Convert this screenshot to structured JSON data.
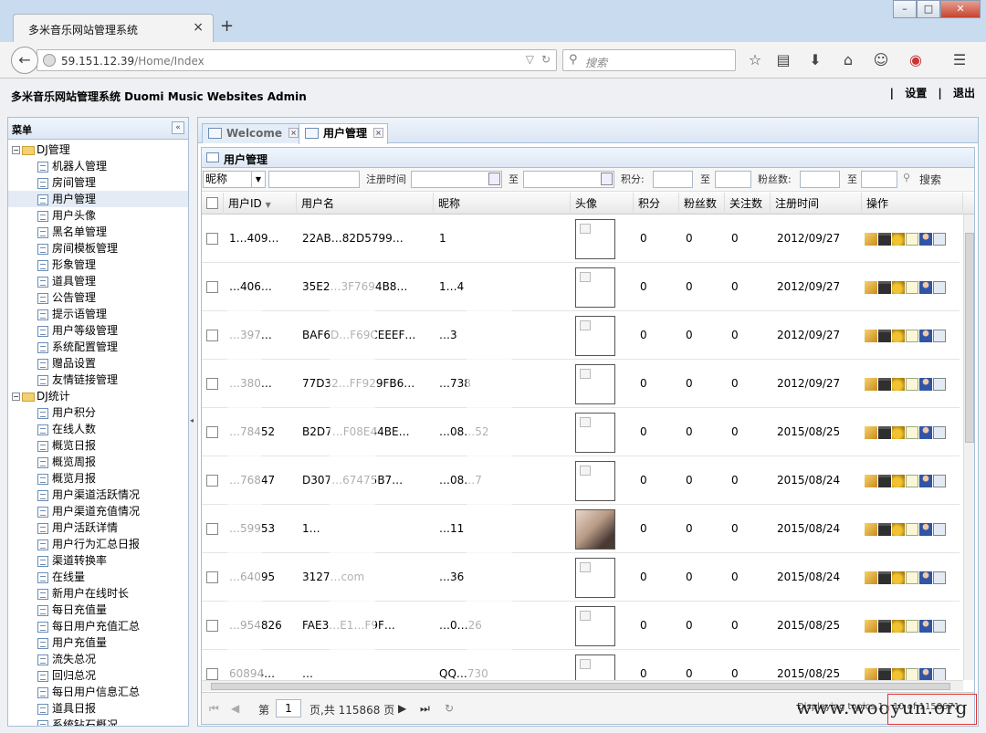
{
  "browser": {
    "tab_title": "多米音乐网站管理系统",
    "tab_close": "×",
    "new_tab": "+",
    "url_host": "59.151.12.39",
    "url_path": "/Home/Index",
    "search_placeholder": "搜索"
  },
  "app": {
    "title": "多米音乐网站管理系统 Duomi Music Websites Admin",
    "links": [
      "设置",
      "退出"
    ],
    "separator": "|"
  },
  "sidebar": {
    "title": "菜单",
    "collapse": "«",
    "groups": [
      {
        "label": "DJ管理",
        "items": [
          "机器人管理",
          "房间管理",
          "用户管理",
          "用户头像",
          "黑名单管理",
          "房间模板管理",
          "形象管理",
          "道具管理",
          "公告管理",
          "提示语管理",
          "用户等级管理",
          "系统配置管理",
          "赠品设置",
          "友情链接管理"
        ]
      },
      {
        "label": "DJ统计",
        "items": [
          "用户积分",
          "在线人数",
          "概览日报",
          "概览周报",
          "概览月报",
          "用户渠道活跃情况",
          "用户渠道充值情况",
          "用户活跃详情",
          "用户行为汇总日报",
          "渠道转换率",
          "在线量",
          "新用户在线时长",
          "每日充值量",
          "每日用户充值汇总",
          "用户充值量",
          "流失总况",
          "回归总况",
          "每日用户信息汇总",
          "道具日报",
          "系统钻石概况"
        ]
      }
    ]
  },
  "tabs": [
    {
      "label": "Welcome",
      "close": "×"
    },
    {
      "label": "用户管理",
      "close": "×"
    }
  ],
  "panel": {
    "title": "用户管理",
    "toolbar": {
      "field_select": "昵称",
      "register_time": "注册时间",
      "to": "至",
      "score": "积分:",
      "fans": "粉丝数:",
      "search": "搜索"
    },
    "columns": [
      "用户ID",
      "用户名",
      "昵称",
      "头像",
      "积分",
      "粉丝数",
      "关注数",
      "注册时间",
      "操作"
    ],
    "rows": [
      {
        "id": "1…409…",
        "username": "22AB…82D5799…",
        "nickname": "1",
        "score": "0",
        "fans": "0",
        "follow": "0",
        "date": "2012/09/27",
        "photo": false
      },
      {
        "id": "…406…",
        "username": "35E2…3F7694B8…",
        "nickname": "1…4",
        "score": "0",
        "fans": "0",
        "follow": "0",
        "date": "2012/09/27",
        "photo": false
      },
      {
        "id": "…397…",
        "username": "BAF6D…F69CEEEF…",
        "nickname": "…3",
        "score": "0",
        "fans": "0",
        "follow": "0",
        "date": "2012/09/27",
        "photo": false
      },
      {
        "id": "…380…",
        "username": "77D32…FF929FB6…",
        "nickname": "…738",
        "score": "0",
        "fans": "0",
        "follow": "0",
        "date": "2012/09/27",
        "photo": false
      },
      {
        "id": "…78452",
        "username": "B2D7…F08E44BE…",
        "nickname": "…08…52",
        "score": "0",
        "fans": "0",
        "follow": "0",
        "date": "2015/08/25",
        "photo": false
      },
      {
        "id": "…76847",
        "username": "D307…67475B7…",
        "nickname": "…08…7",
        "score": "0",
        "fans": "0",
        "follow": "0",
        "date": "2015/08/24",
        "photo": false
      },
      {
        "id": "…59953",
        "username": "1…",
        "nickname": "…11",
        "score": "0",
        "fans": "0",
        "follow": "0",
        "date": "2015/08/24",
        "photo": true
      },
      {
        "id": "…64095",
        "username": "3127…com",
        "nickname": "…36",
        "score": "0",
        "fans": "0",
        "follow": "0",
        "date": "2015/08/24",
        "photo": false
      },
      {
        "id": "…954826",
        "username": "FAE3…E1…F9F…",
        "nickname": "…0…26",
        "score": "0",
        "fans": "0",
        "follow": "0",
        "date": "2015/08/25",
        "photo": false
      },
      {
        "id": "60894…",
        "username": "…",
        "nickname": "QQ…730",
        "score": "0",
        "fans": "0",
        "follow": "0",
        "date": "2015/08/25",
        "photo": false
      }
    ]
  },
  "pager": {
    "page_label": "第",
    "page": "1",
    "total": "页,共 115868 页",
    "display": "Displaying topics 1 - 10 of 1158671"
  },
  "watermark": "www.wooyun.org",
  "colors": {
    "header_bg": "#dde8f5",
    "border": "#a8bfd8",
    "close_btn": "#c6442c"
  }
}
